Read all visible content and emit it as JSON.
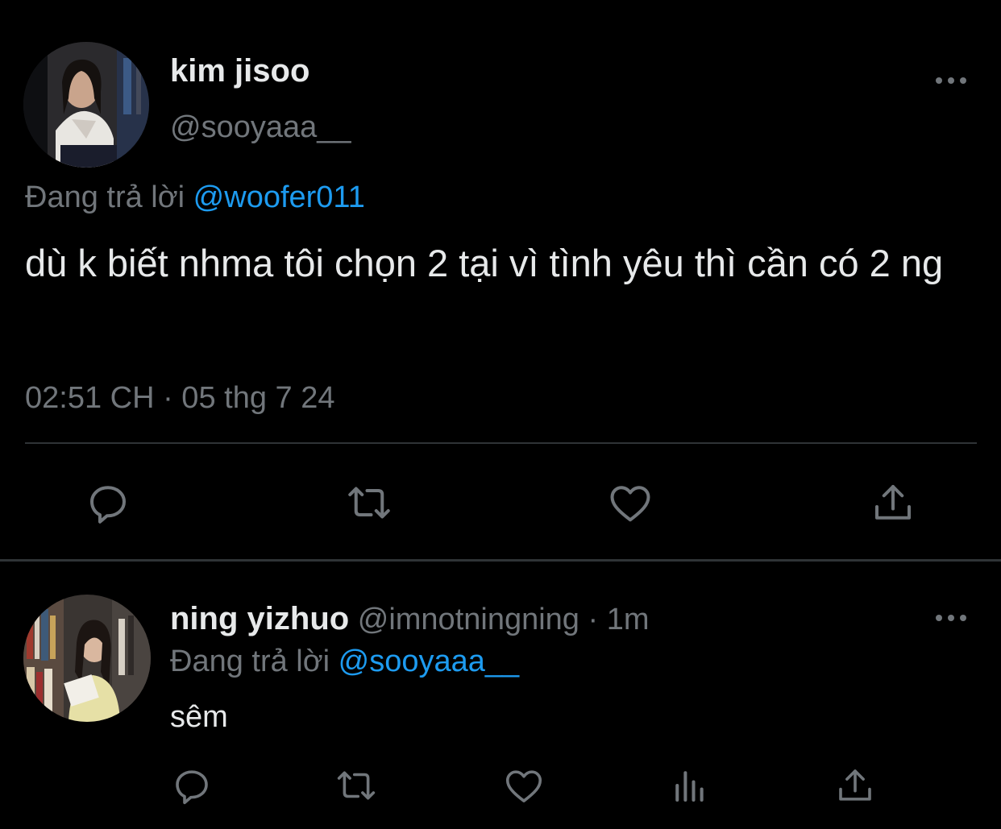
{
  "tweet": {
    "author": {
      "name": "kim jisoo",
      "handle": "@sooyaaa__"
    },
    "reply_prefix": "Đang trả lời",
    "reply_to": "@woofer011",
    "text": "dù k biết nhma tôi chọn 2 tại vì tình yêu thì cần có 2 ng",
    "timestamp": "02:51 CH · 05 thg 7 24",
    "more_icon": "more-horizontal-icon",
    "actions": [
      "reply-icon",
      "retweet-icon",
      "like-icon",
      "share-icon"
    ]
  },
  "reply": {
    "author": {
      "name": "ning yizhuo",
      "handle": "@imnotningning",
      "time": "· 1m"
    },
    "reply_prefix": "Đang trả lời",
    "reply_to": "@sooyaaa__",
    "text": "sêm",
    "more_icon": "more-horizontal-icon",
    "actions": [
      "reply-icon",
      "retweet-icon",
      "like-icon",
      "analytics-icon",
      "share-icon"
    ]
  },
  "colors": {
    "background": "#000000",
    "text": "#e7e9ea",
    "secondary": "#71767b",
    "accent": "#1d9bf0",
    "divider": "#2f3336"
  }
}
